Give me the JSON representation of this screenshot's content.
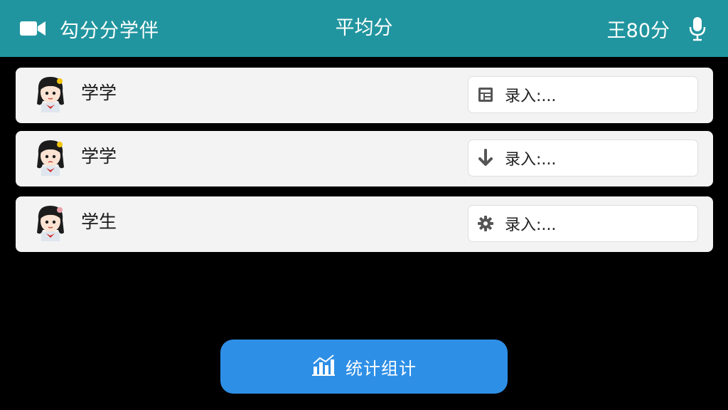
{
  "header": {
    "app_title": "勾分分学伴",
    "center_title": "平均分",
    "score_label": "王80分",
    "video_icon": "video-camera-icon",
    "mic_icon": "microphone-icon"
  },
  "students": [
    {
      "name": "学学",
      "entry_placeholder": "录入:...",
      "entry_icon": "calculator-icon"
    },
    {
      "name": "学学",
      "entry_placeholder": "录入:...",
      "entry_icon": "download-arrow-icon"
    },
    {
      "name": "学生",
      "entry_placeholder": "录入:...",
      "entry_icon": "gear-icon"
    }
  ],
  "footer": {
    "stats_button_label": "统计组计",
    "stats_icon": "chart-icon"
  },
  "colors": {
    "header_bg": "#21959f",
    "page_bg": "#000000",
    "row_bg": "#f3f3f3",
    "button_bg": "#2e8fe6"
  }
}
